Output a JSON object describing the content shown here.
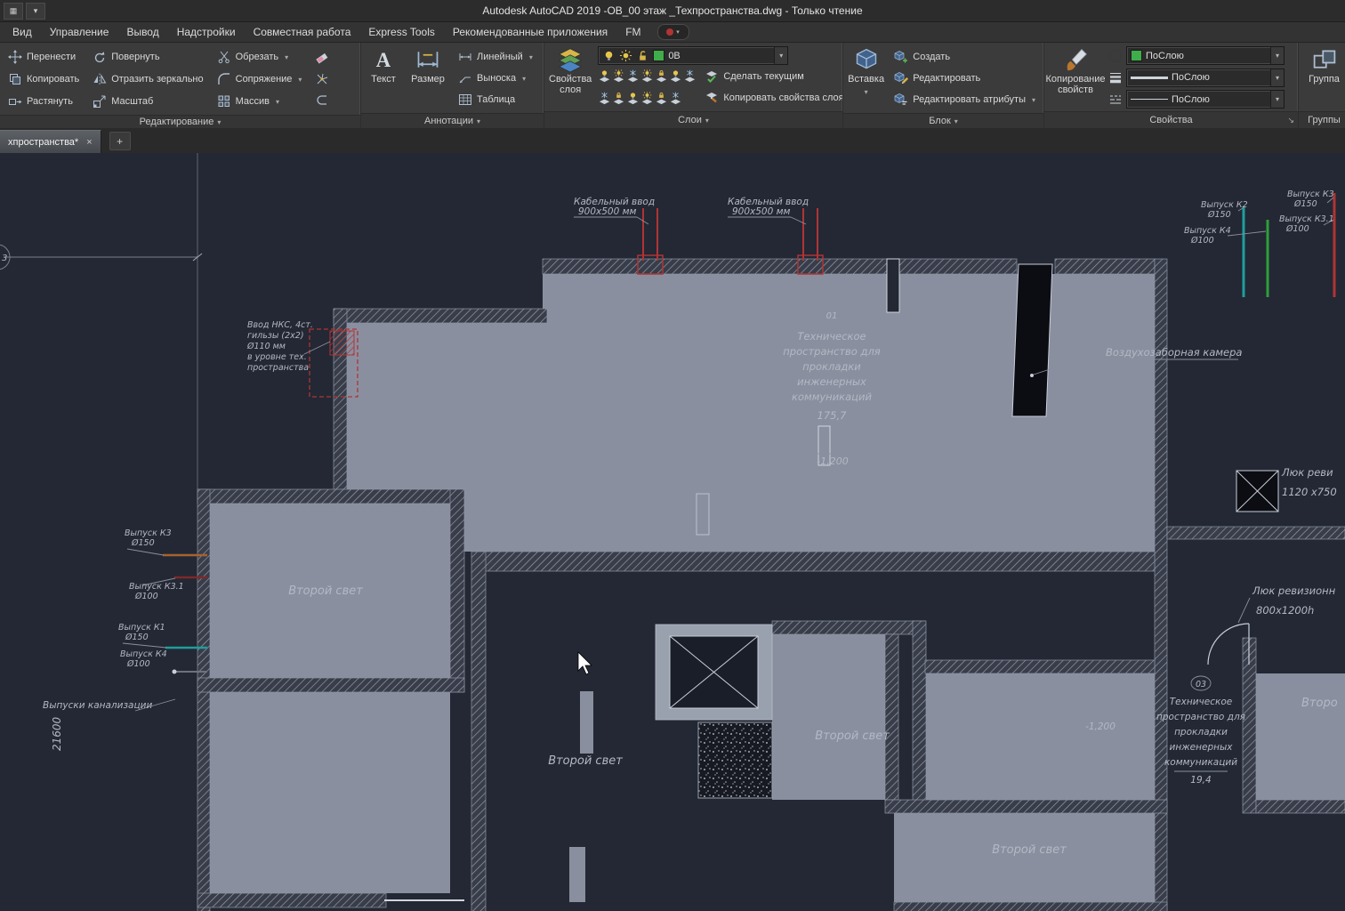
{
  "titlebar": {
    "title": "Autodesk AutoCAD 2019   -ОВ_00 этаж _Техпространства.dwg - Только чтение"
  },
  "menubar": {
    "items": [
      "Вид",
      "Управление",
      "Вывод",
      "Надстройки",
      "Совместная работа",
      "Express Tools",
      "Рекомендованные приложения",
      "FM"
    ]
  },
  "ribbon": {
    "edit": {
      "label": "Редактирование",
      "move": "Перенести",
      "copy": "Копировать",
      "stretch": "Растянуть",
      "rotate": "Повернуть",
      "mirror": "Отразить зеркально",
      "scale": "Масштаб",
      "trim": "Обрезать",
      "fillet": "Сопряжение",
      "array": "Массив"
    },
    "annot": {
      "label": "Аннотации",
      "text": "Текст",
      "dim": "Размер",
      "linear": "Линейный",
      "leader": "Выноска",
      "table": "Таблица"
    },
    "layers": {
      "label": "Слои",
      "props1": "Свойства",
      "props2": "слоя",
      "combo_value": "0В",
      "make_current": "Сделать текущим",
      "copy_props": "Копировать свойства слоя"
    },
    "block": {
      "label": "Блок",
      "insert": "Вставка",
      "create": "Создать",
      "edit": "Редактировать",
      "edit_attrs": "Редактировать атрибуты"
    },
    "props": {
      "label": "Свойства",
      "match1": "Копирование",
      "match2": "свойств",
      "bylayer": "ПоСлою"
    },
    "groups": {
      "label": "Группы",
      "group": "Группа"
    }
  },
  "tabbar": {
    "active_tab": "хпространства*",
    "close": "×",
    "new_tab": "+"
  },
  "canvas": {
    "axis3": "3",
    "dim21600": "21600",
    "cable": {
      "l1": "Кабельный ввод",
      "l2": "900х500 мм"
    },
    "nks": {
      "l1": "Ввод НКС, 4ст.",
      "l2": "гильзы (2х2)",
      "l3": "Ø110 мм",
      "l4": "в уровне тех.",
      "l5": "пространства"
    },
    "room01": {
      "num": "01",
      "l1": "Техническое",
      "l2": "пространство для",
      "l3": "прокладки",
      "l4": "инженерных",
      "l5": "коммуникаций",
      "area": "175,7",
      "level": "-1,200"
    },
    "room03": {
      "num": "03",
      "l1": "Техническое",
      "l2": "пространство для",
      "l3": "прокладки",
      "l4": "инженерных",
      "l5": "коммуникаций",
      "area": "19,4",
      "level": "-1,200"
    },
    "air_chamber": "Воздухозаборная камера",
    "hatch_top": {
      "l1": "Люк реви",
      "l2": "1120 х750"
    },
    "hatch_right": {
      "l1": "Люк ревизионн",
      "l2": "800х1200h"
    },
    "second_light": "Второй свет",
    "second_light_clip": "Второ",
    "k1": {
      "name": "Выпуск К1",
      "dia": "Ø150"
    },
    "k2": {
      "name": "Выпуск К2",
      "dia": "Ø150"
    },
    "k3": {
      "name": "Выпуск К3",
      "dia": "Ø150"
    },
    "k31": {
      "name": "Выпуск К3.1",
      "dia": "Ø100"
    },
    "k4": {
      "name": "Выпуск К4",
      "dia": "Ø100"
    },
    "sewer_outlets": "Выпуски канализации"
  }
}
